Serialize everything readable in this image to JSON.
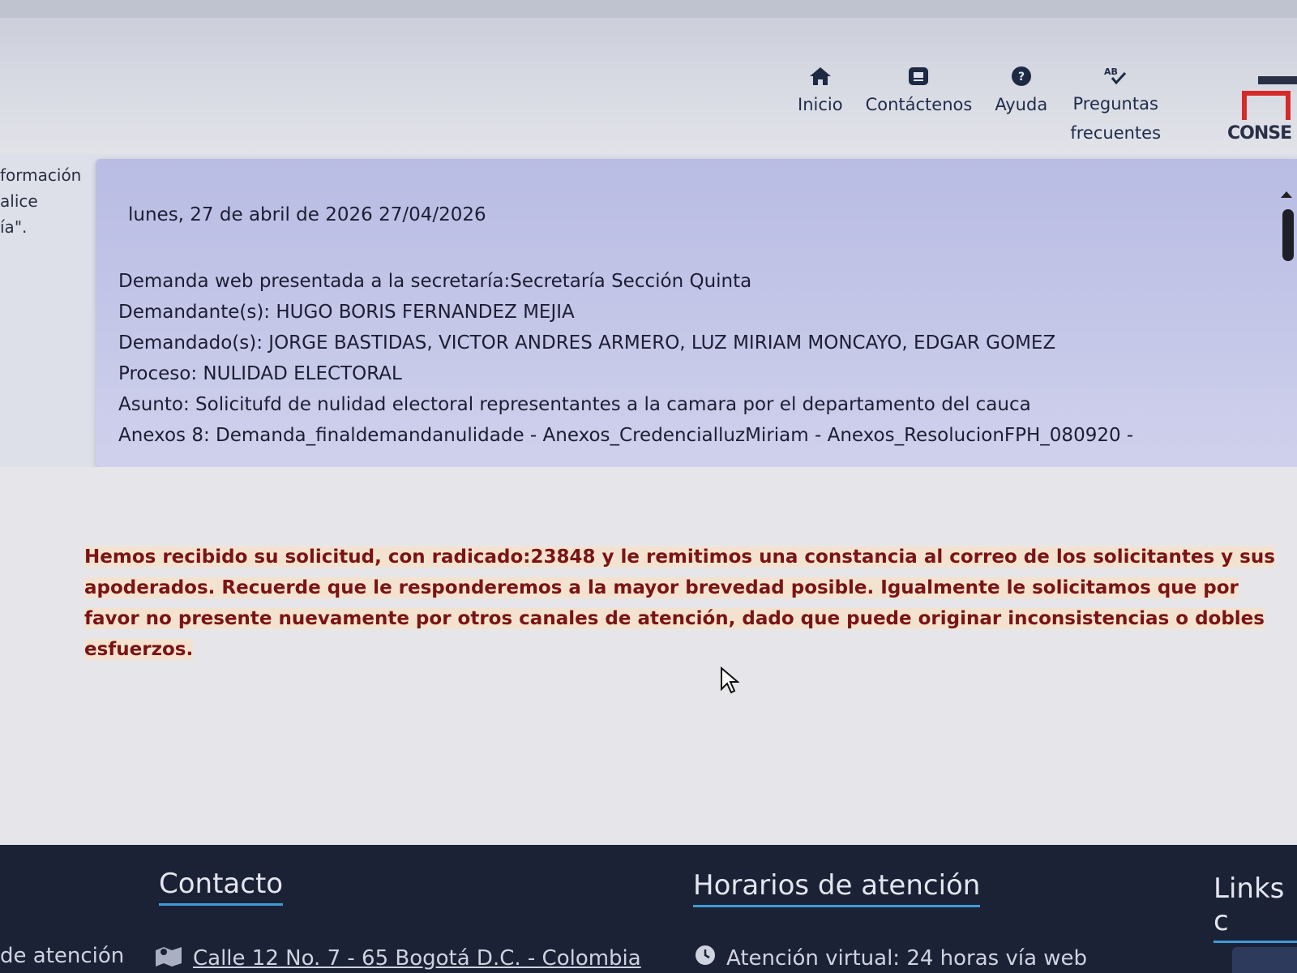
{
  "nav": {
    "items": [
      {
        "label": "Inicio",
        "icon": "home-icon"
      },
      {
        "label": "Contáctenos",
        "icon": "contact-card-icon"
      },
      {
        "label": "Ayuda",
        "icon": "help-icon"
      },
      {
        "label": "Preguntas frecuentes",
        "icon": "faq-icon"
      }
    ]
  },
  "logo": {
    "text": "CONSE"
  },
  "left_fragments": [
    "formación",
    "alice",
    "ía\"."
  ],
  "panel": {
    "date": "lunes, 27 de abril de 2026 27/04/2026",
    "lines": [
      "Demanda web presentada a la secretaría:Secretaría Sección Quinta",
      "Demandante(s): HUGO BORIS FERNANDEZ MEJIA",
      "Demandado(s): JORGE BASTIDAS, VICTOR ANDRES ARMERO, LUZ MIRIAM MONCAYO, EDGAR GOMEZ",
      "Proceso: NULIDAD ELECTORAL",
      "Asunto: Solicitufd de nulidad electoral representantes a la camara por el departamento del cauca",
      "Anexos 8: Demanda_finaldemandanulidade - Anexos_CredencialluzMiriam - Anexos_ResolucionFPH_080920 -"
    ]
  },
  "message": "Hemos recibido su solicitud, con radicado:23848 y le remitimos una constancia al correo de los solicitantes y sus apoderados. Recuerde que le responderemos a la mayor brevedad posible. Igualmente le solicitamos que por favor no presente nuevamente por otros canales de atención, dado que puede originar inconsistencias o dobles esfuerzos.",
  "footer": {
    "contact_title": "Contacto",
    "hours_title": "Horarios de atención",
    "links_title": "Links c",
    "left_fragment": "de atención",
    "address": "Calle 12 No. 7 - 65 Bogotá D.C. - Colombia",
    "virtual_hours": "Atención virtual: 24 horas vía web"
  },
  "colors": {
    "panel": "#c4c6e8",
    "message_text": "#7a1414",
    "footer_bg": "#1c2236",
    "accent": "#3f9bd8",
    "logo_red": "#d62a2a"
  }
}
